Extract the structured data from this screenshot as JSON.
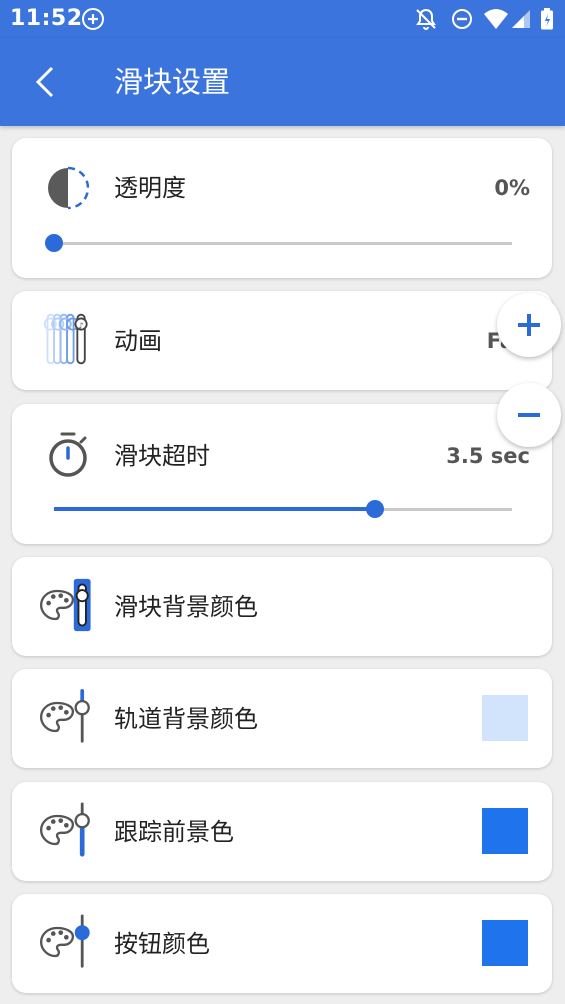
{
  "status_bar": {
    "time": "11:52",
    "icons": [
      "add-circle-icon",
      "notifications-off-icon",
      "do-not-disturb-icon",
      "wifi-icon",
      "signal-icon",
      "battery-icon"
    ]
  },
  "app_bar": {
    "title": "滑块设置",
    "back_icon": "back-arrow-icon",
    "color": "#3a74dc"
  },
  "settings": [
    {
      "id": "opacity",
      "label": "透明度",
      "value": "0%",
      "slider_level": 0.0,
      "icon": "half-circle-icon"
    },
    {
      "id": "animation",
      "label": "动画",
      "value": "Fa",
      "icon": "animation-slider-icon"
    },
    {
      "id": "slider_timeout",
      "label": "滑块超时",
      "value": "3.5 sec",
      "slider_level": 0.7,
      "icon": "stopwatch-icon"
    },
    {
      "id": "slider_bg_color",
      "label": "滑块背景颜色",
      "icon": "palette-slider-icon"
    },
    {
      "id": "track_bg_color",
      "label": "轨道背景颜色",
      "swatch_color": "#d2e3fc",
      "icon": "palette-slider-icon"
    },
    {
      "id": "track_fg_color",
      "label": "跟踪前景色",
      "swatch_color": "#1f74ee",
      "icon": "palette-slider-icon"
    },
    {
      "id": "button_color",
      "label": "按钮颜色",
      "swatch_color": "#1f74ee",
      "icon": "palette-slider-icon"
    }
  ],
  "fabs": [
    {
      "id": "increase",
      "icon": "plus-icon"
    },
    {
      "id": "decrease",
      "icon": "minus-icon"
    }
  ],
  "accent_color": "#2a6ad9"
}
